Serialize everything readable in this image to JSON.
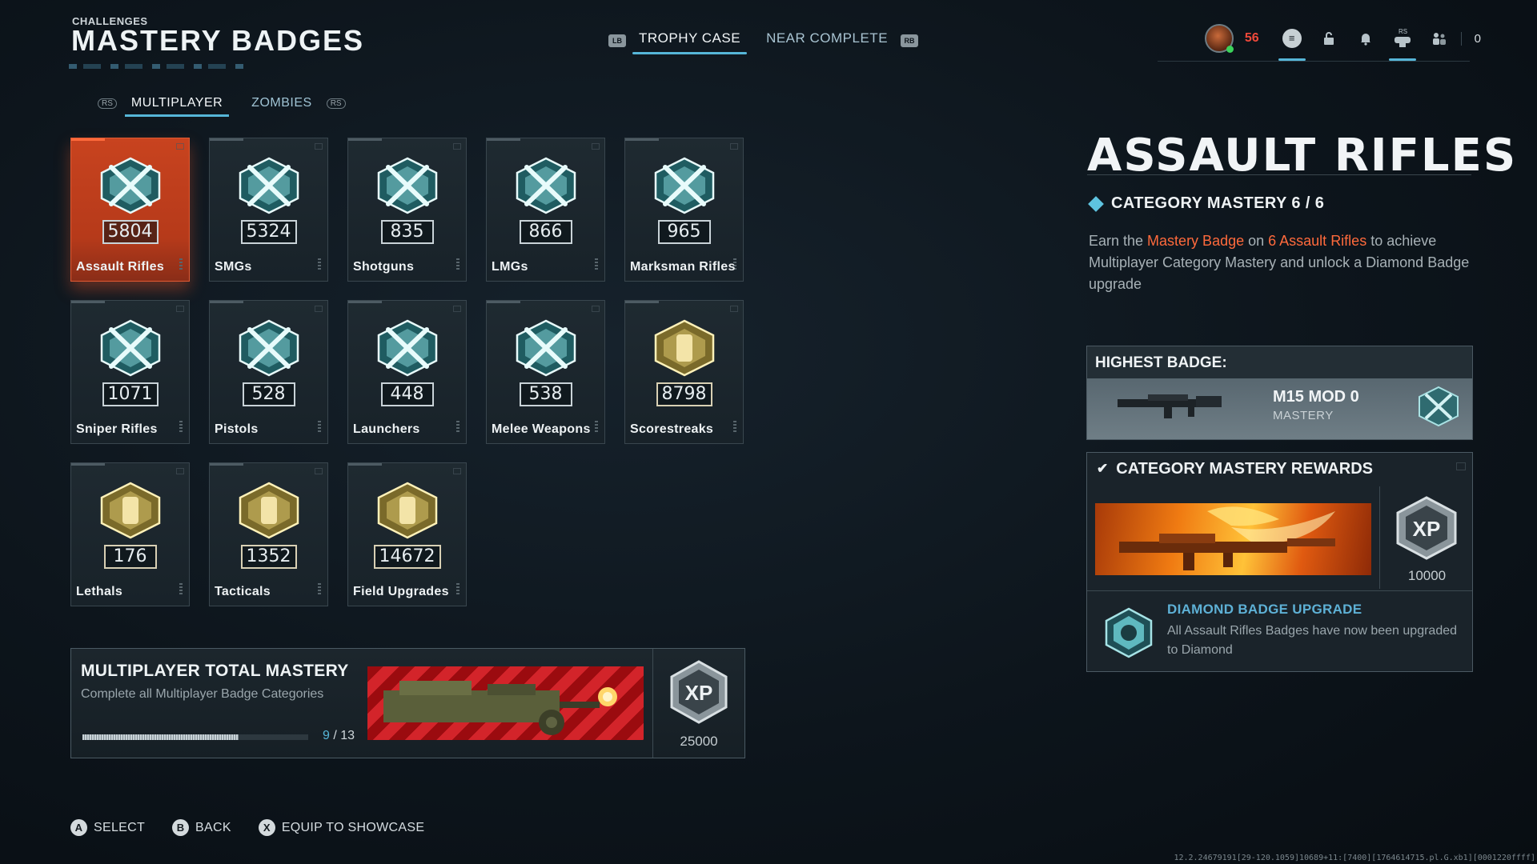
{
  "header": {
    "section": "CHALLENGES",
    "title": "MASTERY BADGES",
    "lb": "LB",
    "rb": "RB",
    "tabs": [
      {
        "label": "TROPHY CASE",
        "active": true
      },
      {
        "label": "NEAR COMPLETE",
        "active": false
      }
    ]
  },
  "status": {
    "level": "56",
    "friends_count": "0",
    "rs_label": "RS",
    "icons": [
      "menu-icon",
      "lock-icon",
      "bell-icon",
      "controller-icon",
      "friends-icon"
    ]
  },
  "mode_tabs": {
    "ls": "RS",
    "rs": "RS",
    "items": [
      {
        "label": "MULTIPLAYER",
        "active": true
      },
      {
        "label": "ZOMBIES",
        "active": false
      }
    ]
  },
  "badges": [
    {
      "label": "Assault Rifles",
      "count": "5804",
      "tier": "diamond",
      "selected": true
    },
    {
      "label": "SMGs",
      "count": "5324",
      "tier": "diamond"
    },
    {
      "label": "Shotguns",
      "count": "835",
      "tier": "diamond"
    },
    {
      "label": "LMGs",
      "count": "866",
      "tier": "diamond"
    },
    {
      "label": "Marksman Rifles",
      "count": "965",
      "tier": "diamond"
    },
    {
      "label": "Sniper Rifles",
      "count": "1071",
      "tier": "diamond"
    },
    {
      "label": "Pistols",
      "count": "528",
      "tier": "diamond"
    },
    {
      "label": "Launchers",
      "count": "448",
      "tier": "diamond"
    },
    {
      "label": "Melee Weapons",
      "count": "538",
      "tier": "diamond"
    },
    {
      "label": "Scorestreaks",
      "count": "8798",
      "tier": "gold"
    },
    {
      "label": "Lethals",
      "count": "176",
      "tier": "gold"
    },
    {
      "label": "Tacticals",
      "count": "1352",
      "tier": "gold"
    },
    {
      "label": "Field Upgrades",
      "count": "14672",
      "tier": "gold"
    }
  ],
  "total_mastery": {
    "title": "MULTIPLAYER TOTAL MASTERY",
    "subtitle": "Complete all Multiplayer Badge Categories",
    "progress_current": "9",
    "progress_sep": " / ",
    "progress_total": "13",
    "progress_fraction": 0.69,
    "xp_reward": "25000"
  },
  "detail": {
    "title": "ASSAULT RIFLES",
    "category_mastery": "CATEGORY MASTERY 6 / 6",
    "desc_1": "Earn the ",
    "desc_hl1": "Mastery Badge",
    "desc_2": " on ",
    "desc_hl2": "6 Assault Rifles",
    "desc_3": " to achieve Multiplayer Category Mastery and unlock a Diamond Badge upgrade",
    "highest_badge_label": "HIGHEST BADGE:",
    "weapon_name": "M15 MOD 0",
    "weapon_sub": "MASTERY",
    "rewards_label": "CATEGORY MASTERY REWARDS",
    "xp_reward": "10000",
    "upgrade_title": "DIAMOND BADGE UPGRADE",
    "upgrade_desc": "All Assault Rifles Badges have now been upgraded to Diamond"
  },
  "footer": [
    {
      "key": "A",
      "label": "SELECT"
    },
    {
      "key": "B",
      "label": "BACK"
    },
    {
      "key": "X",
      "label": "EQUIP TO SHOWCASE"
    }
  ],
  "debug_text": "12.2.24679191[29-120.1059]10689+11:[7400][1764614715.pl.G.xb1][0001220ffff]",
  "colors": {
    "accent": "#56b6d8",
    "selected": "#c8431f",
    "highlight": "#ff6a3c",
    "level": "#f0493a",
    "upgrade_title": "#5eb1d6"
  }
}
